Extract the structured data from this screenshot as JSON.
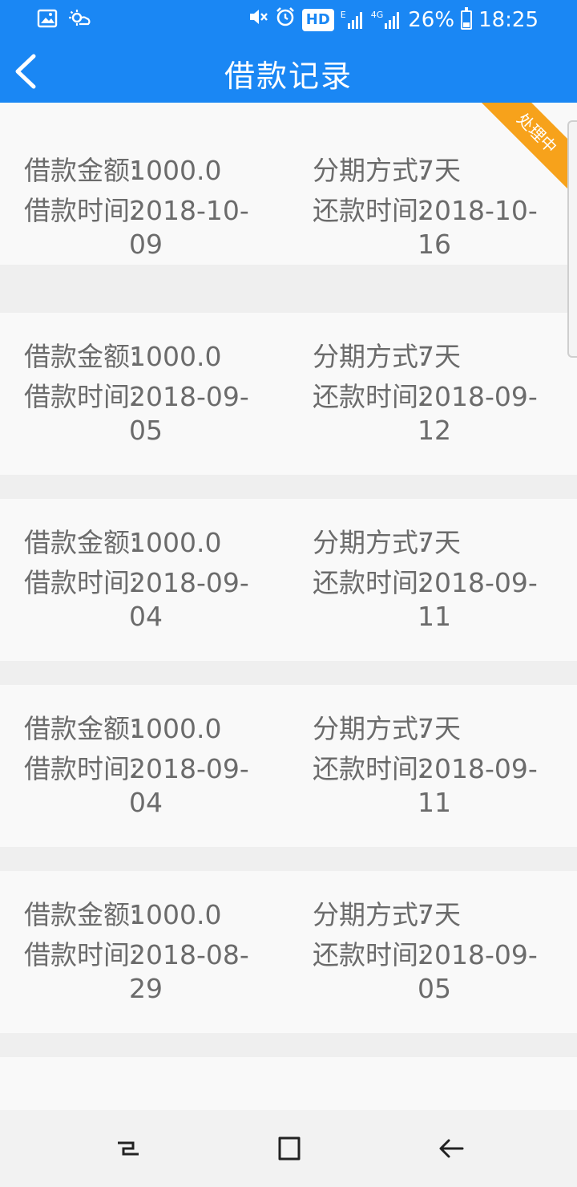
{
  "status_bar": {
    "hd": "HD",
    "signal1_tag": "E",
    "signal2_tag": "4G",
    "battery": "26%",
    "time": "18:25"
  },
  "header": {
    "title": "借款记录"
  },
  "loans": [
    {
      "amount_label": "借款金额:",
      "amount": "1000.0",
      "term_label": "分期方式:",
      "term": "7天",
      "borrow_label": "借款时间:",
      "borrow_date": "2018-10-09",
      "repay_label": "还款时间:",
      "repay_date": "2018-10-16",
      "status": "处理中"
    },
    {
      "amount_label": "借款金额:",
      "amount": "1000.0",
      "term_label": "分期方式:",
      "term": "7天",
      "borrow_label": "借款时间:",
      "borrow_date": "2018-09-05",
      "repay_label": "还款时间:",
      "repay_date": "2018-09-12"
    },
    {
      "amount_label": "借款金额:",
      "amount": "1000.0",
      "term_label": "分期方式:",
      "term": "7天",
      "borrow_label": "借款时间:",
      "borrow_date": "2018-09-04",
      "repay_label": "还款时间:",
      "repay_date": "2018-09-11"
    },
    {
      "amount_label": "借款金额:",
      "amount": "1000.0",
      "term_label": "分期方式:",
      "term": "7天",
      "borrow_label": "借款时间:",
      "borrow_date": "2018-09-04",
      "repay_label": "还款时间:",
      "repay_date": "2018-09-11"
    },
    {
      "amount_label": "借款金额:",
      "amount": "1000.0",
      "term_label": "分期方式:",
      "term": "7天",
      "borrow_label": "借款时间:",
      "borrow_date": "2018-08-29",
      "repay_label": "还款时间:",
      "repay_date": "2018-09-05"
    }
  ],
  "icons": {
    "status_left": [
      "image-icon",
      "weather-icon"
    ],
    "status_right": [
      "mute-icon",
      "alarm-icon",
      "signal-icon",
      "signal-icon",
      "battery-icon"
    ],
    "nav": [
      "recent-apps-icon",
      "home-icon",
      "back-icon"
    ]
  },
  "colors": {
    "primary": "#1a87f4",
    "status_ribbon": "#f7a21b",
    "card": "#f9f9f9",
    "background": "#efefef",
    "text": "#6b6b6b"
  }
}
